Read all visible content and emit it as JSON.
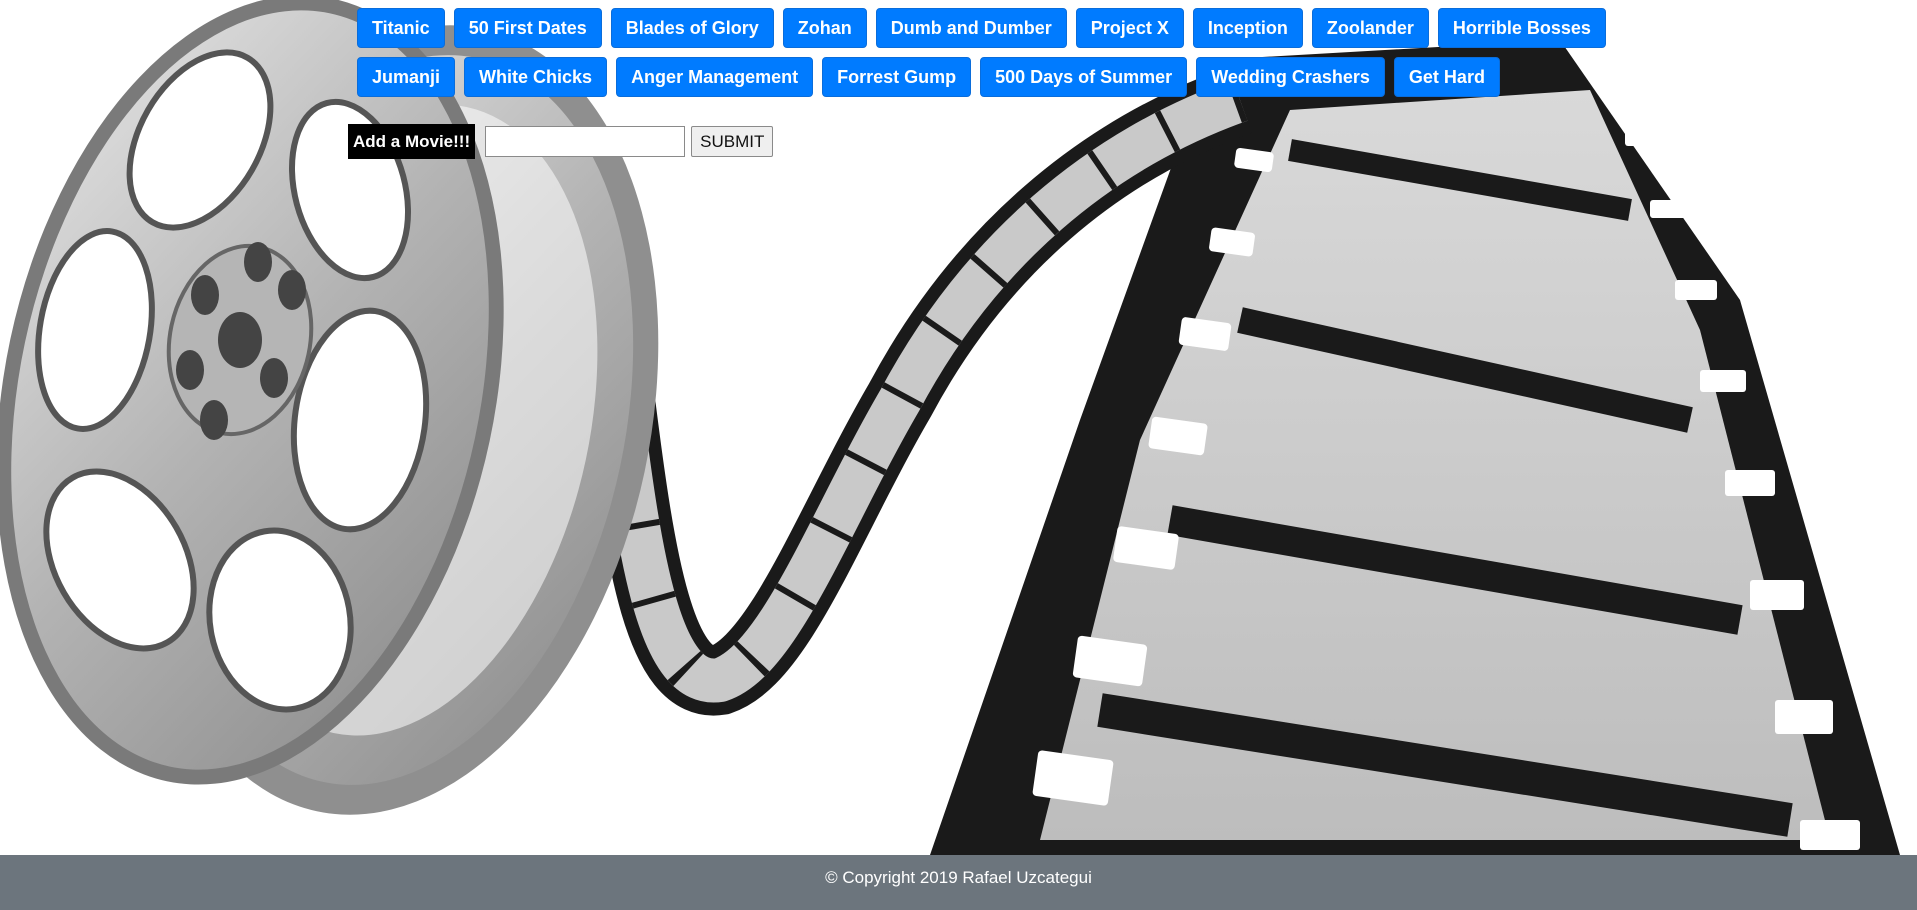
{
  "movies_row1": [
    "Titanic",
    "50 First Dates",
    "Blades of Glory",
    "Zohan",
    "Dumb and Dumber",
    "Project X",
    "Inception",
    "Zoolander",
    "Horrible Bosses"
  ],
  "movies_row2": [
    "Jumanji",
    "White Chicks",
    "Anger Management",
    "Forrest Gump",
    "500 Days of Summer",
    "Wedding Crashers",
    "Get Hard"
  ],
  "form": {
    "label": "Add a Movie!!!",
    "input_value": "",
    "submit_label": "SUBMIT"
  },
  "footer": {
    "text": "© Copyright 2019 Rafael Uzcategui"
  },
  "colors": {
    "button_bg": "#007bff",
    "footer_bg": "#6c757d",
    "label_bg": "#000000"
  },
  "background": {
    "image": "film-reel-icon"
  }
}
